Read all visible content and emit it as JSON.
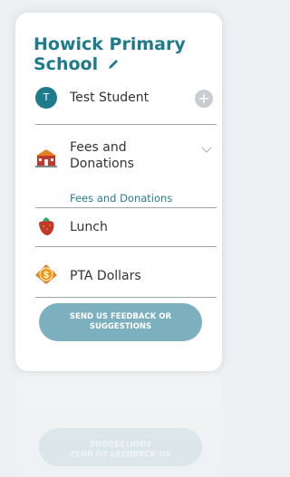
{
  "school": {
    "name": "Howick Primary School",
    "edit_icon": "pencil-icon"
  },
  "student": {
    "initial": "T",
    "name": "Test Student",
    "add_icon": "plus-circle-icon"
  },
  "menu": {
    "fees": {
      "label_line1": "Fees and",
      "label_line2": "Donations",
      "icon": "school-building-icon",
      "expand_icon": "chevron-down-icon",
      "sub_item": "Fees and Donations"
    },
    "lunch": {
      "label": "Lunch",
      "icon": "strawberry-icon"
    },
    "pta": {
      "label": "PTA Dollars",
      "icon": "dollar-coin-icon"
    }
  },
  "feedback": {
    "line1": "SEND US FEEDBACK OR",
    "line2": "SUGGESTIONS"
  },
  "colors": {
    "brand": "#1f7a8c",
    "button": "#7db0bf",
    "background": "#eef1f3"
  }
}
